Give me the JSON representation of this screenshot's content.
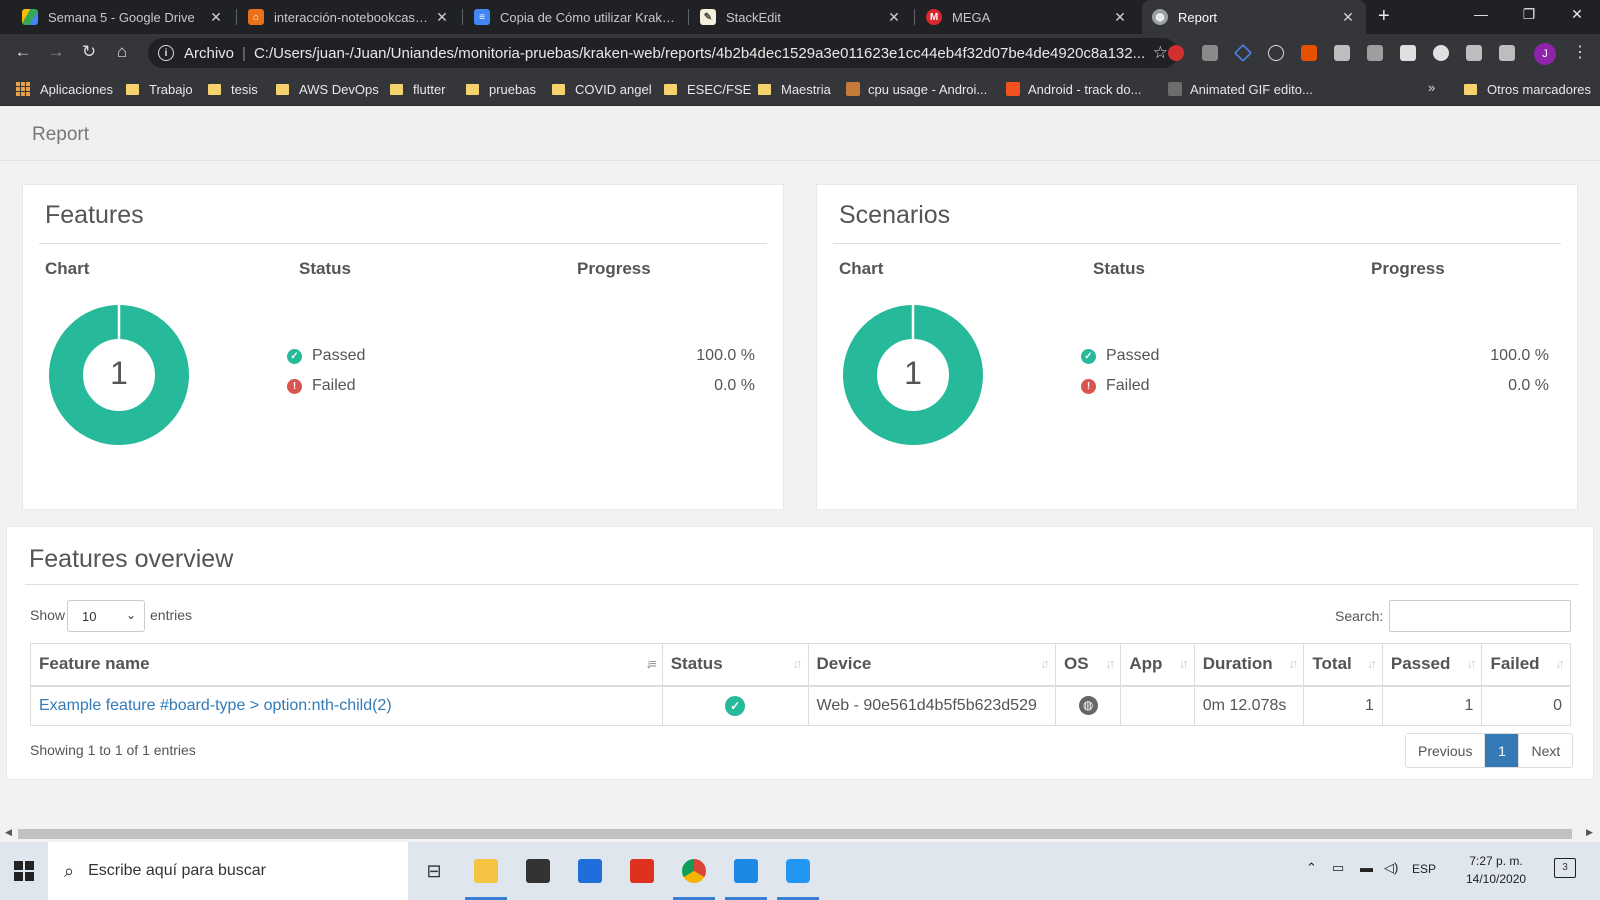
{
  "browser": {
    "tabs": [
      {
        "title": "Semana 5 - Google Drive",
        "icon": "google-drive-icon"
      },
      {
        "title": "interacción-notebookcast - d",
        "icon": "gitlab-icon"
      },
      {
        "title": "Copia de Cómo utilizar Kraken",
        "icon": "google-docs-icon"
      },
      {
        "title": "StackEdit",
        "icon": "stackedit-icon"
      },
      {
        "title": "MEGA",
        "icon": "mega-icon"
      },
      {
        "title": "Report",
        "icon": "globe-icon"
      }
    ],
    "new_tab": "+",
    "address": {
      "security_label": "Archivo",
      "url": "C:/Users/juan-/Juan/Uniandes/monitoria-pruebas/kraken-web/reports/4b2b4dec1529a3e011623e1cc44eb4f32d07be4de4920c8a132..."
    },
    "profile_initial": "J",
    "bookmarks": [
      "Aplicaciones",
      "Trabajo",
      "tesis",
      "AWS DevOps",
      "flutter",
      "pruebas",
      "COVID angel",
      "ESEC/FSE",
      "Maestria",
      "cpu usage - Androi...",
      "Android - track do...",
      "Animated GIF edito..."
    ],
    "bookmarks_more": "»",
    "other_bookmarks": "Otros marcadores"
  },
  "report": {
    "brand": "Report",
    "features": {
      "title": "Features",
      "col_chart": "Chart",
      "col_status": "Status",
      "col_progress": "Progress",
      "donut_value": "1",
      "passed_fraction": 1.0,
      "passed_label": "Passed",
      "failed_label": "Failed",
      "passed_pct": "100.0 %",
      "failed_pct": "0.0 %"
    },
    "scenarios": {
      "title": "Scenarios",
      "col_chart": "Chart",
      "col_status": "Status",
      "col_progress": "Progress",
      "donut_value": "1",
      "passed_fraction": 1.0,
      "passed_label": "Passed",
      "failed_label": "Failed",
      "passed_pct": "100.0 %",
      "failed_pct": "0.0 %"
    },
    "overview": {
      "title": "Features overview",
      "show_label": "Show",
      "entries_value": "10",
      "entries_label": "entries",
      "search_label": "Search:",
      "search_value": "",
      "columns": [
        "Feature name",
        "Status",
        "Device",
        "OS",
        "App",
        "Duration",
        "Total",
        "Passed",
        "Failed"
      ],
      "rows": [
        {
          "feature_name": "Example feature #board-type > option:nth-child(2)",
          "status": "passed",
          "device": "Web - 90e561d4b5f5b623d529",
          "os": "web",
          "app": "",
          "duration": "0m 12.078s",
          "total": "1",
          "passed": "1",
          "failed": "0"
        }
      ],
      "info": "Showing 1 to 1 of 1 entries",
      "pager": {
        "previous": "Previous",
        "current": "1",
        "next": "Next"
      }
    }
  },
  "taskbar": {
    "search_placeholder": "Escribe aquí para buscar",
    "language": "ESP",
    "time": "7:27 p. m.",
    "date": "14/10/2020",
    "notifications": "3"
  },
  "colors": {
    "accent_green": "#26b99a",
    "fail_red": "#d9534f",
    "link_blue": "#337ab7"
  }
}
